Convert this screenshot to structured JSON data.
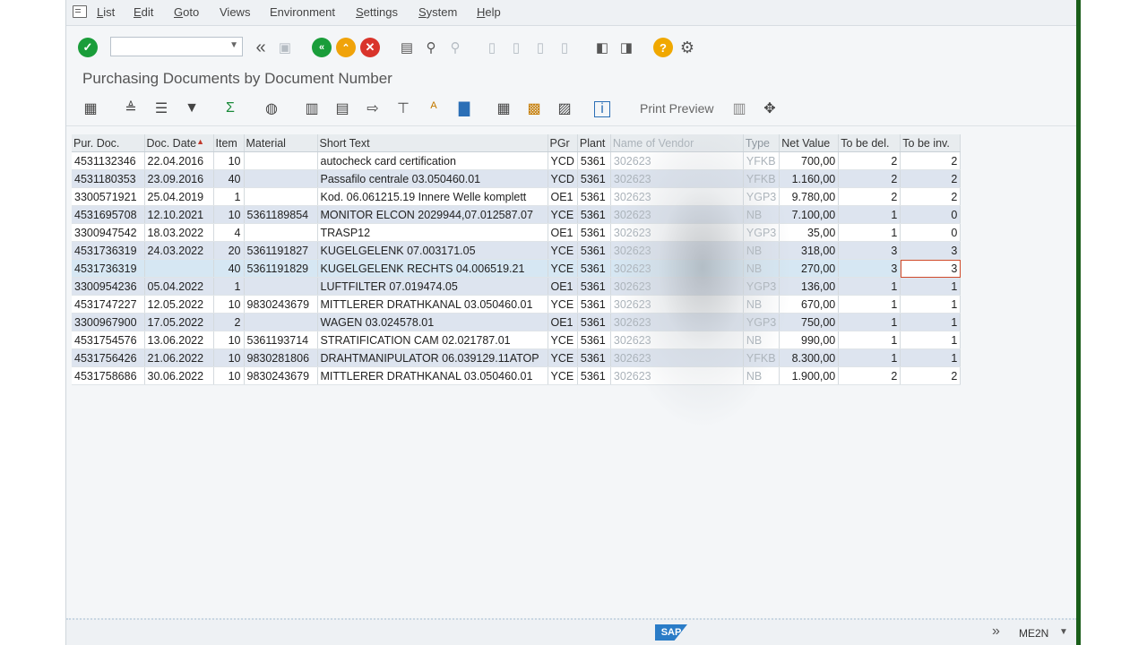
{
  "menu": {
    "items": [
      {
        "label": "List",
        "ul": "L",
        "rest": "ist"
      },
      {
        "label": "Edit",
        "ul": "E",
        "rest": "dit"
      },
      {
        "label": "Goto",
        "ul": "G",
        "rest": "oto"
      },
      {
        "label": "Views",
        "ul": "",
        "rest": "Views"
      },
      {
        "label": "Environment",
        "ul": "",
        "rest": "Environment"
      },
      {
        "label": "Settings",
        "ul": "S",
        "rest": "ettings"
      },
      {
        "label": "System",
        "ul": "S",
        "rest": "ystem"
      },
      {
        "label": "Help",
        "ul": "H",
        "rest": "elp"
      }
    ]
  },
  "command_field": {
    "value": ""
  },
  "title": "Purchasing Documents by Document Number",
  "app_toolbar": {
    "print_preview": "Print Preview"
  },
  "table": {
    "headers": [
      "Pur. Doc.",
      "Doc. Date",
      "Item",
      "Material",
      "Short Text",
      "PGr",
      "Plant",
      "Name of Vendor",
      "Type",
      "Net Value",
      "To be del.",
      "To be inv."
    ],
    "rows": [
      [
        "4531132346",
        "22.04.2016",
        "10",
        "",
        "autocheck card certification",
        "YCD",
        "5361",
        "302623",
        "YFKB",
        "700,00",
        "2",
        "2"
      ],
      [
        "4531180353",
        "23.09.2016",
        "40",
        "",
        "Passafilo centrale        03.050460.01",
        "YCD",
        "5361",
        "302623",
        "YFKB",
        "1.160,00",
        "2",
        "2"
      ],
      [
        "3300571921",
        "25.04.2019",
        "1",
        "",
        "Kod. 06.061215.19 Innere Welle komplett",
        "OE1",
        "5361",
        "302623",
        "YGP3",
        "9.780,00",
        "2",
        "2"
      ],
      [
        "4531695708",
        "12.10.2021",
        "10",
        "5361189854",
        "MONITOR ELCON 2029944,07.012587.07",
        "YCE",
        "5361",
        "302623",
        "NB",
        "7.100,00",
        "1",
        "0"
      ],
      [
        "3300947542",
        "18.03.2022",
        "4",
        "",
        "TRASP12",
        "OE1",
        "5361",
        "302623",
        "YGP3",
        "35,00",
        "1",
        "0"
      ],
      [
        "4531736319",
        "24.03.2022",
        "20",
        "5361191827",
        "KUGELGELENK 07.003171.05",
        "YCE",
        "5361",
        "302623",
        "NB",
        "318,00",
        "3",
        "3"
      ],
      [
        "4531736319",
        "",
        "40",
        "5361191829",
        "KUGELGELENK RECHTS 04.006519.21",
        "YCE",
        "5361",
        "302623",
        "NB",
        "270,00",
        "3",
        "3"
      ],
      [
        "3300954236",
        "05.04.2022",
        "1",
        "",
        "LUFTFILTER 07.019474.05",
        "OE1",
        "5361",
        "302623",
        "YGP3",
        "136,00",
        "1",
        "1"
      ],
      [
        "4531747227",
        "12.05.2022",
        "10",
        "9830243679",
        "MITTLERER DRATHKANAL 03.050460.01",
        "YCE",
        "5361",
        "302623",
        "NB",
        "670,00",
        "1",
        "1"
      ],
      [
        "3300967900",
        "17.05.2022",
        "2",
        "",
        "WAGEN  03.024578.01",
        "OE1",
        "5361",
        "302623",
        "YGP3",
        "750,00",
        "1",
        "1"
      ],
      [
        "4531754576",
        "13.06.2022",
        "10",
        "5361193714",
        "STRATIFICATION CAM 02.021787.01",
        "YCE",
        "5361",
        "302623",
        "NB",
        "990,00",
        "1",
        "1"
      ],
      [
        "4531756426",
        "21.06.2022",
        "10",
        "9830281806",
        "DRAHTMANIPULATOR 06.039129.11ATOP",
        "YCE",
        "5361",
        "302623",
        "YFKB",
        "8.300,00",
        "1",
        "1"
      ],
      [
        "4531758686",
        "30.06.2022",
        "10",
        "9830243679",
        "MITTLERER DRATHKANAL 03.050460.01",
        "YCE",
        "5361",
        "302623",
        "NB",
        "1.900,00",
        "2",
        "2"
      ]
    ]
  },
  "status_bar": {
    "tcode": "ME2N",
    "logo": "SAP"
  },
  "colors": {
    "accent_green": "#1a9d3a",
    "cancel_red": "#d9342b",
    "warn_orange": "#f0a30a",
    "help_yellow": "#f0a800",
    "row_stripe": "#dde4ef"
  }
}
